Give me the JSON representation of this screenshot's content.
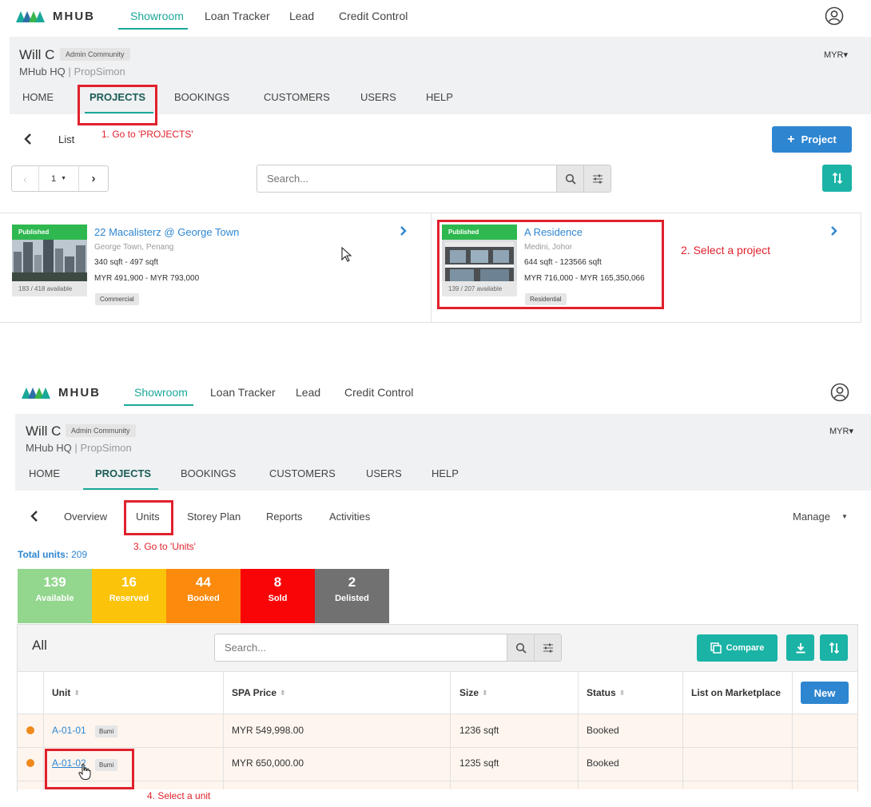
{
  "colors": {
    "teal": "#1aa89a",
    "blue": "#2e86d1",
    "red_annotation": "#e0212c",
    "published": "#2eb84f"
  },
  "logo": {
    "text": "MHUB"
  },
  "topnav": {
    "items": [
      "Showroom",
      "Loan Tracker",
      "Lead",
      "Credit Control"
    ],
    "active": "Showroom"
  },
  "user": {
    "name": "Will C",
    "role": "Admin Community",
    "org": "MHub HQ",
    "agency": "PropSimon",
    "currency": "MYR▾"
  },
  "secnav": {
    "items": [
      "HOME",
      "PROJECTS",
      "BOOKINGS",
      "CUSTOMERS",
      "USERS",
      "HELP"
    ],
    "active": "PROJECTS"
  },
  "list_view": {
    "back_label": "List",
    "add_project_label": "Project",
    "pager_value": "1",
    "search_placeholder": "Search...",
    "projects": [
      {
        "status": "Published",
        "title": "22 Macalisterz @ George Town",
        "location": "George Town, Penang",
        "size": "340 sqft - 497 sqft",
        "price": "MYR 491,900 - MYR 793,000",
        "availability": "183 / 418  available",
        "tag": "Commercial"
      },
      {
        "status": "Published",
        "title": "A Residence",
        "location": "Medini, Johor",
        "size": "644 sqft - 123566 sqft",
        "price": "MYR 716,000 - MYR 165,350,066",
        "availability": "139 / 207  available",
        "tag": "Residential"
      }
    ]
  },
  "annotations": {
    "step1": "1. Go to 'PROJECTS'",
    "step2": "2. Select a project",
    "step3": "3. Go to 'Units'",
    "step4": "4. Select a unit"
  },
  "project_view": {
    "tabs": [
      "Overview",
      "Units",
      "Storey Plan",
      "Reports",
      "Activities"
    ],
    "active_tab": "Units",
    "manage_label": "Manage",
    "total_units_label": "Total units:",
    "total_units_value": "209",
    "stats": [
      {
        "value": "139",
        "label": "Available",
        "color": "#93d68e"
      },
      {
        "value": "16",
        "label": "Reserved",
        "color": "#fbc30a"
      },
      {
        "value": "44",
        "label": "Booked",
        "color": "#fb8a0d"
      },
      {
        "value": "8",
        "label": "Sold",
        "color": "#f90407"
      },
      {
        "value": "2",
        "label": "Delisted",
        "color": "#717171"
      }
    ],
    "filter_title": "All",
    "search_placeholder": "Search...",
    "compare_label": "Compare",
    "new_label": "New",
    "columns": [
      "Unit",
      "SPA Price",
      "Size",
      "Status",
      "List on Marketplace"
    ],
    "rows": [
      {
        "unit": "A-01-01",
        "badge": "Bumi",
        "price": "MYR 549,998.00",
        "size": "1236 sqft",
        "status": "Booked"
      },
      {
        "unit": "A-01-02",
        "badge": "Bumi",
        "price": "MYR 650,000.00",
        "size": "1235 sqft",
        "status": "Booked"
      }
    ]
  }
}
